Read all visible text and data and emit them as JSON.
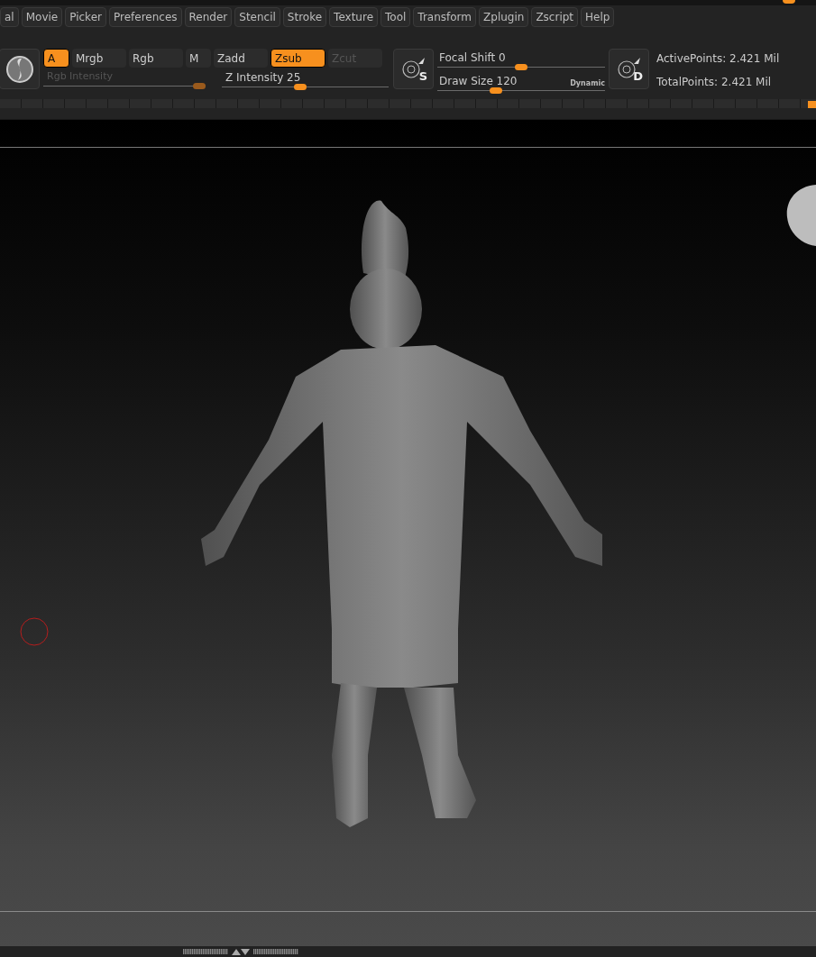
{
  "menu": [
    "al",
    "Movie",
    "Picker",
    "Preferences",
    "Render",
    "Stencil",
    "Stroke",
    "Texture",
    "Tool",
    "Transform",
    "Zplugin",
    "Zscript",
    "Help"
  ],
  "modes": [
    {
      "label": "A",
      "selected": true,
      "disabled": false
    },
    {
      "label": "Mrgb",
      "selected": false,
      "disabled": false
    },
    {
      "label": "Rgb",
      "selected": false,
      "disabled": false
    },
    {
      "label": "M",
      "selected": false,
      "disabled": false
    },
    {
      "label": "Zadd",
      "selected": false,
      "disabled": false
    },
    {
      "label": "Zsub",
      "selected": true,
      "disabled": false
    },
    {
      "label": "Zcut",
      "selected": false,
      "disabled": true
    }
  ],
  "rgb_intensity": {
    "label": "Rgb Intensity",
    "disabled": true,
    "level": 0.96
  },
  "z_intensity": {
    "label": "Z Intensity 25",
    "disabled": false,
    "level": 0.47
  },
  "focal_shift": {
    "label": "Focal Shift 0",
    "level": 0.5
  },
  "draw_size": {
    "label": "Draw Size 120",
    "level": 0.35,
    "badge": "Dynamic"
  },
  "brush_buttons": [
    "S",
    "D"
  ],
  "stats": [
    "ActivePoints: 2.421 Mil",
    "TotalPoints: 2.421 Mil"
  ]
}
